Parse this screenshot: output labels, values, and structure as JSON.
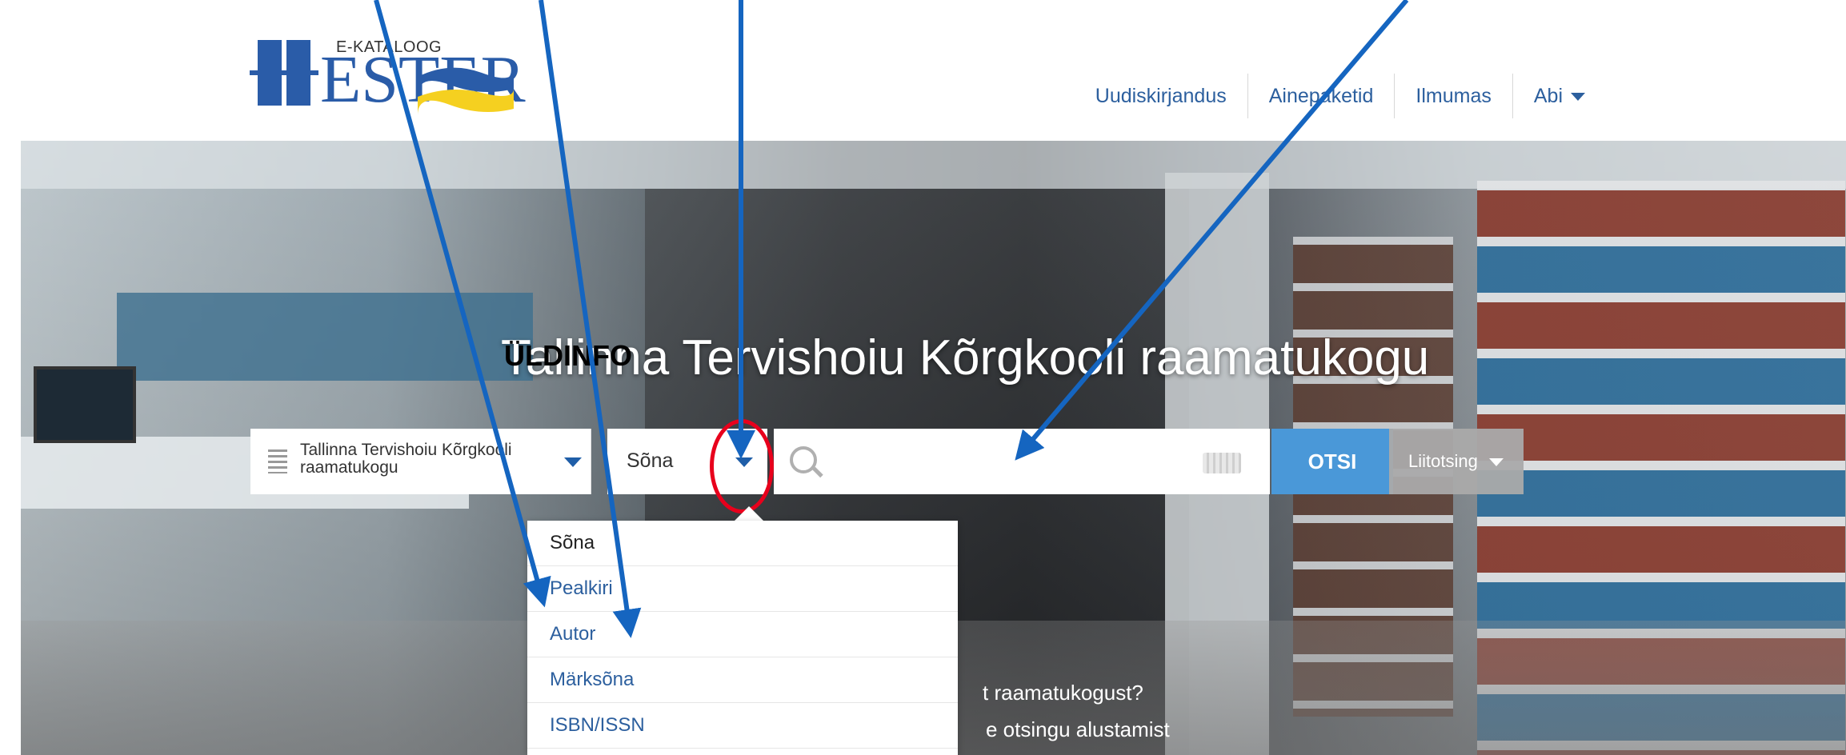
{
  "logo": {
    "small_text": "E-KATALOOG",
    "big_text": "ESTER",
    "colors": {
      "blue": "#2a5ca8",
      "yellow": "#f5d020"
    }
  },
  "nav": {
    "items": [
      {
        "label": "Uudiskirjandus"
      },
      {
        "label": "Ainepaketid"
      },
      {
        "label": "Ilmumas"
      },
      {
        "label": "Abi"
      }
    ]
  },
  "hero": {
    "title": "Tallinna Tervishoiu Kõrgkooli raamatukogu",
    "tag": "ÜLDINFO",
    "info_line1": "t raamatukogust?",
    "info_line2": "e otsingu alustamist"
  },
  "search": {
    "library_label": "Tallinna Tervishoiu Kõrgkooli raamatukogu",
    "type_label": "Sõna",
    "input_value": "",
    "submit_label": "OTSI",
    "advanced_label": "Liitotsing"
  },
  "dropdown": {
    "options": [
      {
        "label": "Sõna",
        "selected": true
      },
      {
        "label": "Pealkiri",
        "selected": false
      },
      {
        "label": "Autor",
        "selected": false
      },
      {
        "label": "Märksõna",
        "selected": false
      },
      {
        "label": "ISBN/ISSN",
        "selected": false
      }
    ]
  },
  "colors": {
    "accent": "#4a98d8",
    "link": "#2c5f9e",
    "annotation_arrow": "#1565c0",
    "annotation_circle": "#e8001c"
  }
}
